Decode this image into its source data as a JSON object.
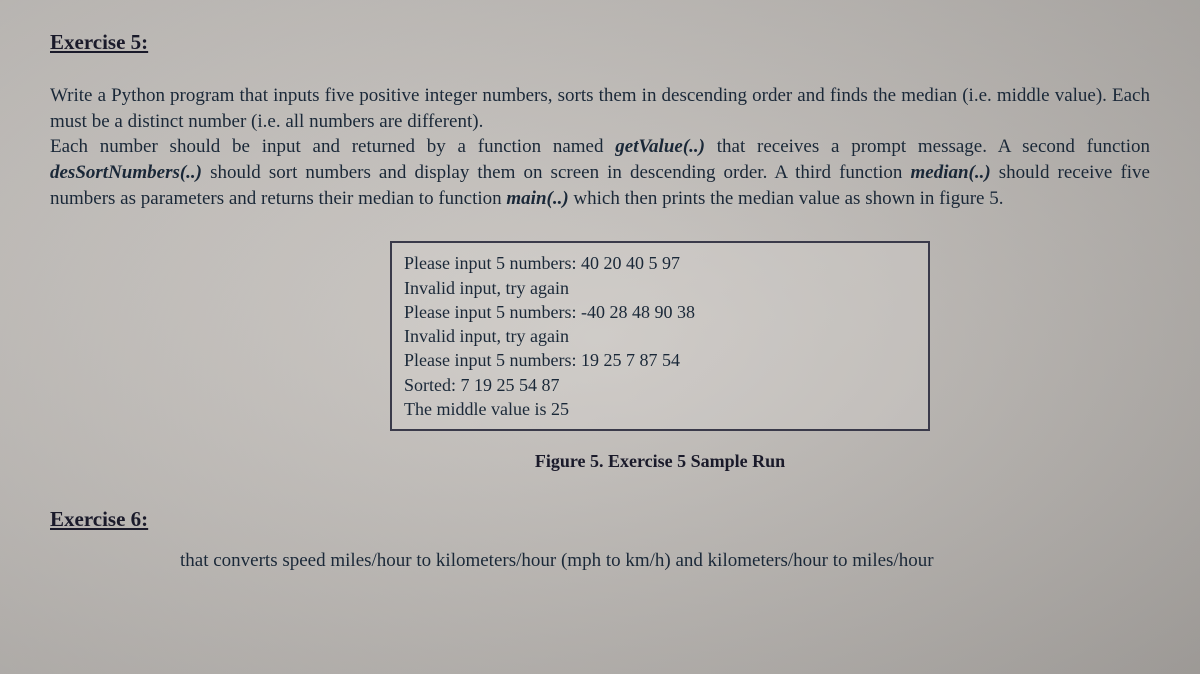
{
  "exercise5": {
    "heading": "Exercise 5:",
    "para_part1": "Write a Python program that inputs five positive integer numbers, sorts them in descending order and finds the median (i.e. middle value). Each must be a distinct number (i.e. all numbers are different).",
    "para_part2a": "Each number should be input and returned by a function named ",
    "func1": "getValue(..)",
    "para_part2b": " that receives a prompt message. A second function ",
    "func2": "desSortNumbers(..)",
    "para_part2c": " should sort numbers and display them on screen in descending order. A third function ",
    "func3": "median(..)",
    "para_part2d": " should receive five numbers as parameters and returns their median to function ",
    "func4": "main(..)",
    "para_part2e": " which then prints the median value as shown in figure 5."
  },
  "sample": {
    "line1": "Please input 5 numbers: 40 20 40 5 97",
    "line2": "Invalid input, try again",
    "line3": "Please input 5 numbers: -40 28 48 90 38",
    "line4": "Invalid input, try again",
    "line5": "Please input 5 numbers: 19 25 7 87 54",
    "line6": "Sorted: 7 19 25 54 87",
    "line7": "The middle value is 25"
  },
  "figure_caption": "Figure 5. Exercise 5 Sample Run",
  "exercise6": {
    "heading": "Exercise 6:",
    "partial_text": "that converts speed miles/hour to kilometers/hour (mph to km/h) and kilometers/hour to miles/hour"
  }
}
